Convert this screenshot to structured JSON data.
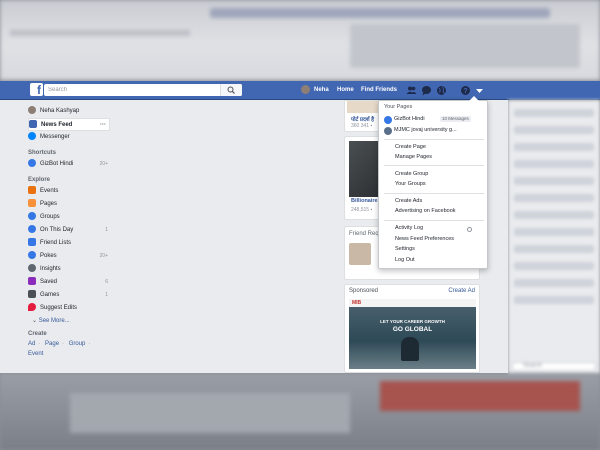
{
  "header": {
    "logo": "f",
    "search_placeholder": "Search",
    "user_name": "Neha",
    "home": "Home",
    "find_friends": "Find Friends",
    "brand_color": "#4267b2"
  },
  "sidebar": {
    "user": "Neha Kashyap",
    "items": [
      {
        "label": "News Feed",
        "icon": "news-feed-icon",
        "color": "#4267b2"
      },
      {
        "label": "Messenger",
        "icon": "messenger-icon",
        "color": "#0084ff"
      }
    ],
    "shortcuts_title": "Shortcuts",
    "shortcuts": [
      {
        "label": "GizBot Hindi",
        "count": "20+",
        "color": "#3578e5"
      }
    ],
    "explore_title": "Explore",
    "explore": [
      {
        "label": "Events",
        "count": "",
        "color": "#e9710f"
      },
      {
        "label": "Pages",
        "count": "",
        "color": "#f7923a"
      },
      {
        "label": "Groups",
        "count": "",
        "color": "#3578e5"
      },
      {
        "label": "On This Day",
        "count": "1",
        "color": "#3578e5"
      },
      {
        "label": "Friend Lists",
        "count": "",
        "color": "#3578e5"
      },
      {
        "label": "Pokes",
        "count": "20+",
        "color": "#3578e5"
      },
      {
        "label": "Insights",
        "count": "",
        "color": "#606770"
      },
      {
        "label": "Saved",
        "count": "6",
        "color": "#8c2cbb"
      },
      {
        "label": "Games",
        "count": "1",
        "color": "#4b4f56"
      },
      {
        "label": "Suggest Edits",
        "count": "",
        "color": "#e41e3f"
      }
    ],
    "see_more": "See More...",
    "create_title": "Create",
    "create_links": [
      "Ad",
      "Page",
      "Group",
      "Event"
    ]
  },
  "feed": {
    "card1_title": "पोर्ट प्रदर्श है",
    "card1_stats": "360 341 ▪",
    "card2_title": "Billionaire",
    "card2_stats": "248,515 ▪",
    "card3_title": "Friend Req",
    "sponsored": "Sponsored",
    "create_ad": "Create Ad",
    "ad_brand": "MIB",
    "ad_line1": "LET YOUR CAREER GROWTH",
    "ad_line2": "GO GLOBAL"
  },
  "dropdown": {
    "your_pages": "Your Pages",
    "pages": [
      {
        "name": "GizBot Hindi",
        "badge": "10 Messages",
        "color": "#3578e5"
      },
      {
        "name": "MJMC jovaj university g...",
        "badge": "",
        "color": "#5b6f8a"
      }
    ],
    "items": [
      "Create Page",
      "Manage Pages",
      "Create Group",
      "Your Groups",
      "Create Ads",
      "Advertising on Facebook",
      "Activity Log",
      "News Feed Preferences",
      "Settings",
      "Log Out"
    ]
  },
  "right_search": "Search"
}
